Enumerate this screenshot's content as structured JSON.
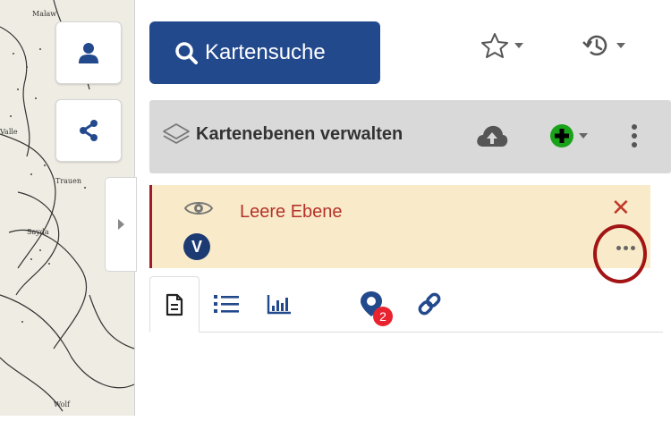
{
  "search": {
    "label": "Kartensuche"
  },
  "layers_panel": {
    "title": "Kartenebenen verwalten"
  },
  "layer": {
    "name": "Leere Ebene",
    "type_badge": "V"
  },
  "tabs": {
    "items": [
      {
        "icon": "document-icon"
      },
      {
        "icon": "list-icon"
      },
      {
        "icon": "bar-chart-icon"
      },
      {
        "icon": "map-marker-icon",
        "badge": "2"
      },
      {
        "icon": "link-icon"
      }
    ]
  },
  "colors": {
    "primary": "#23498d",
    "layer_highlight_bg": "#f9ebc9",
    "layer_name": "#b5322a",
    "add_green": "#1aa31a",
    "badge_red": "#e8232f"
  }
}
